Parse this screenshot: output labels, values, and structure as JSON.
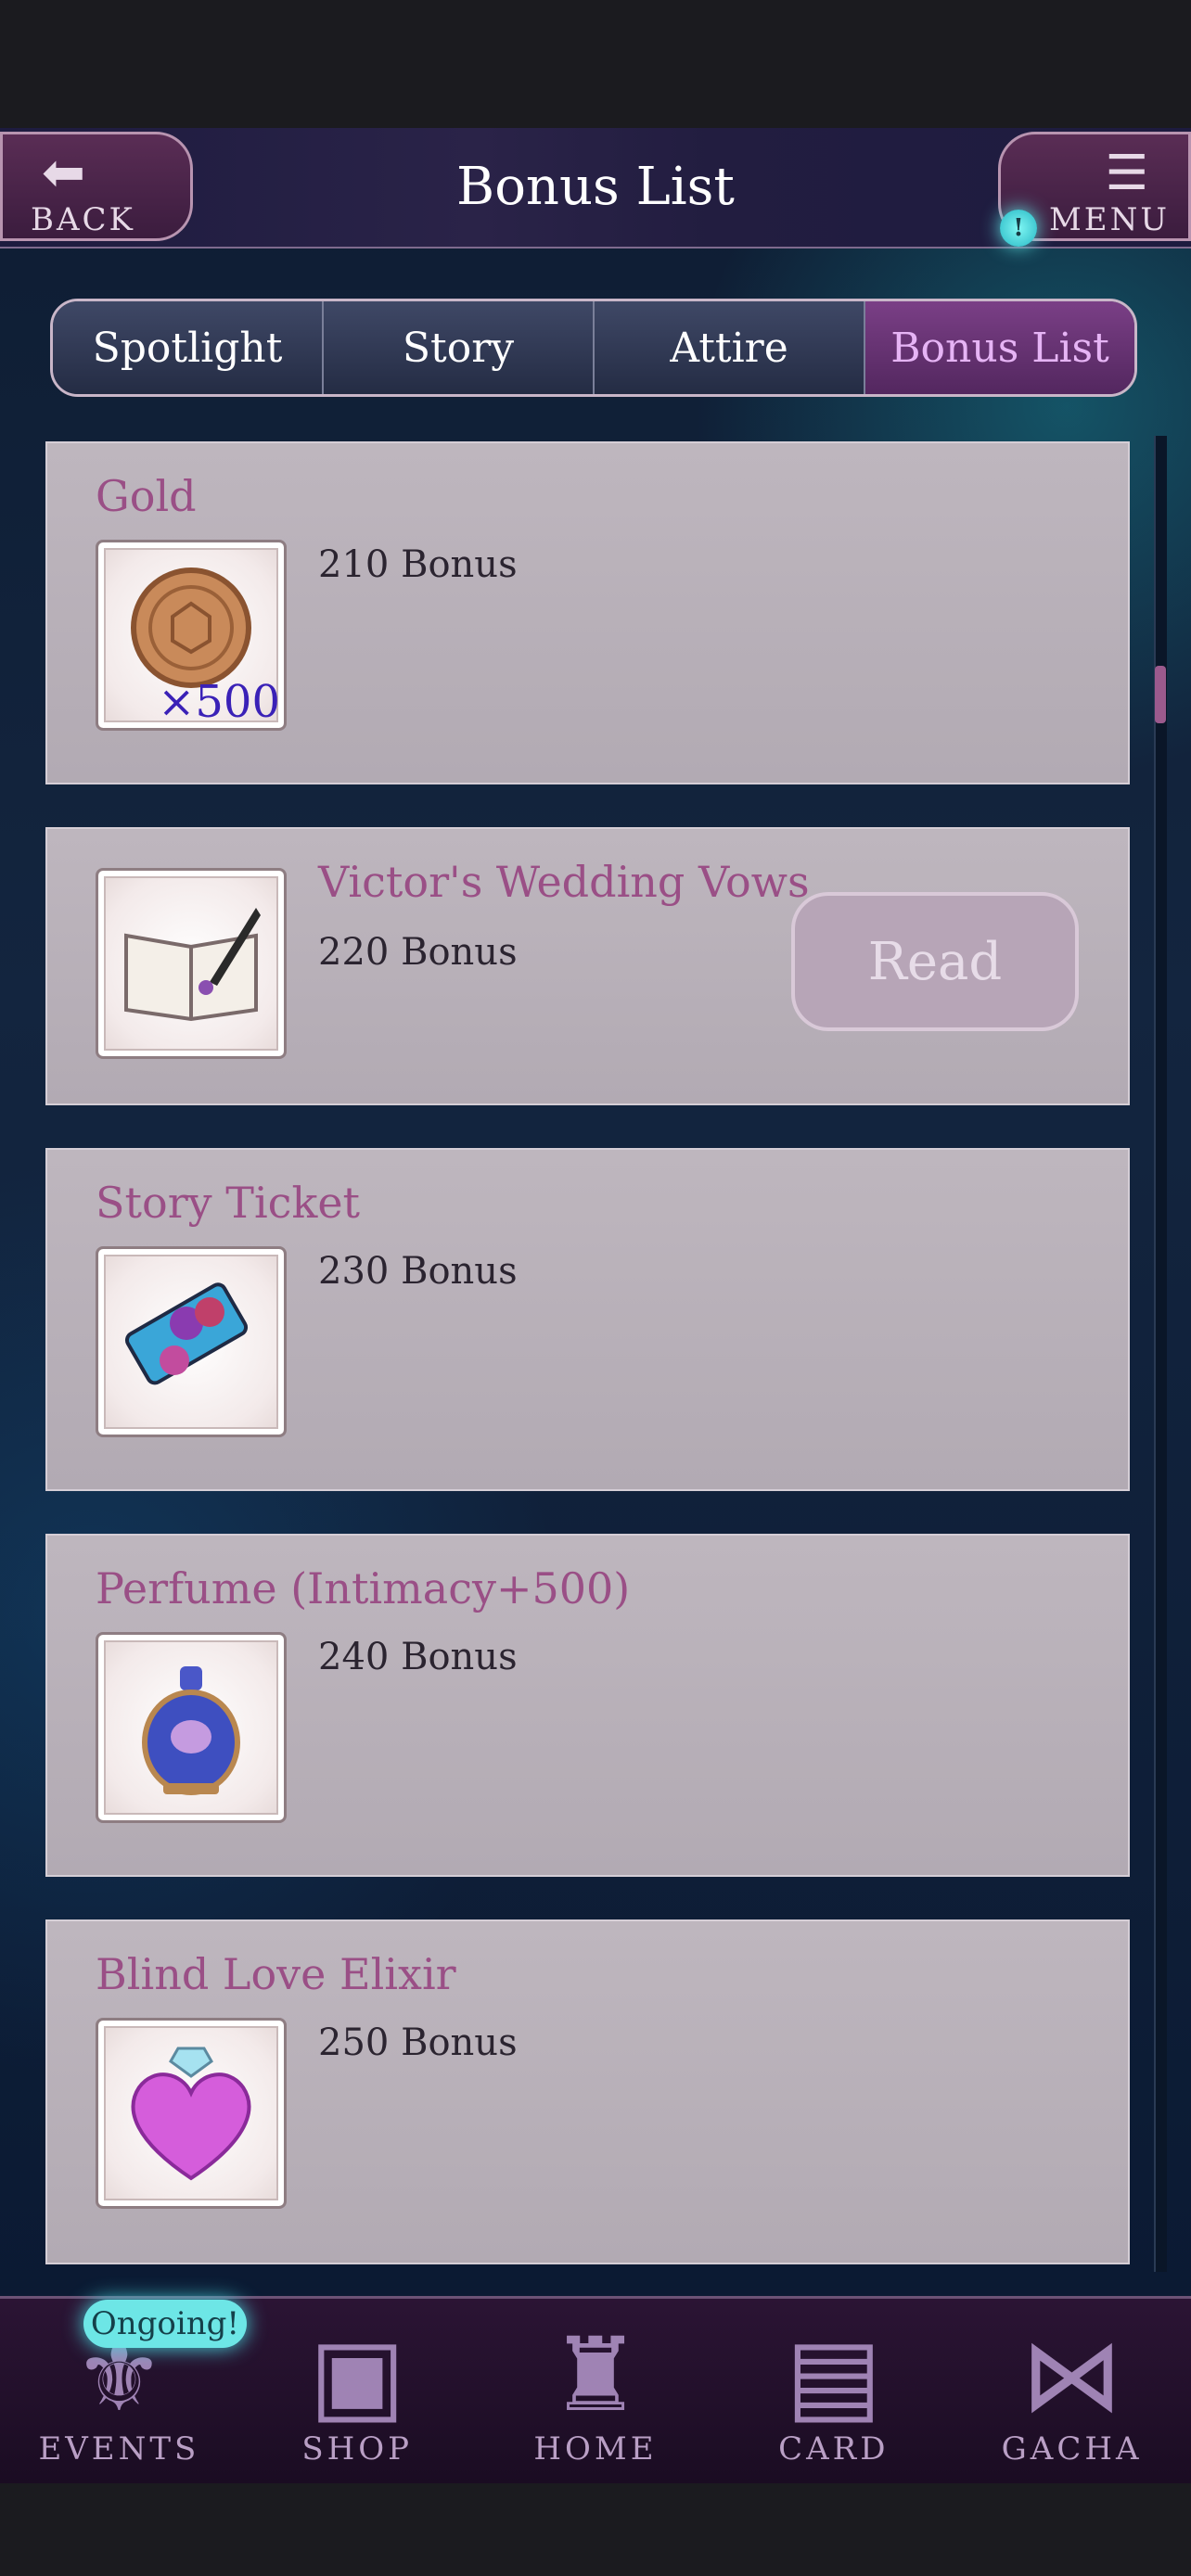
{
  "header": {
    "title": "Bonus List",
    "back_label": "BACK",
    "menu_label": "MENU",
    "menu_badge": "!"
  },
  "tabs": [
    {
      "label": "Spotlight",
      "active": false
    },
    {
      "label": "Story",
      "active": false
    },
    {
      "label": "Attire",
      "active": false
    },
    {
      "label": "Bonus List",
      "active": true
    }
  ],
  "items": [
    {
      "name": "Gold",
      "bonus": "210 Bonus",
      "icon": "gold-coin-icon",
      "quantity": "×500"
    },
    {
      "name": "Victor's Wedding Vows",
      "bonus": "220 Bonus",
      "icon": "book-quill-icon",
      "action": "Read"
    },
    {
      "name": "Story Ticket",
      "bonus": "230 Bonus",
      "icon": "rose-ticket-icon"
    },
    {
      "name": "Perfume (Intimacy+500)",
      "bonus": "240 Bonus",
      "icon": "perfume-bottle-icon"
    },
    {
      "name": "Blind Love Elixir",
      "bonus": "250 Bonus",
      "icon": "heart-elixir-icon"
    }
  ],
  "nav": {
    "ongoing_badge": "Ongoing!",
    "items": [
      {
        "label": "EVENTS",
        "icon": "events-icon"
      },
      {
        "label": "SHOP",
        "icon": "shop-sign-icon"
      },
      {
        "label": "HOME",
        "icon": "castle-icon"
      },
      {
        "label": "CARD",
        "icon": "cards-icon"
      },
      {
        "label": "GACHA",
        "icon": "butterfly-icon"
      }
    ]
  },
  "colors": {
    "item_name": "#9a4f86",
    "active_tab_text": "#e6b4f5",
    "quantity": "#3a21b7"
  }
}
